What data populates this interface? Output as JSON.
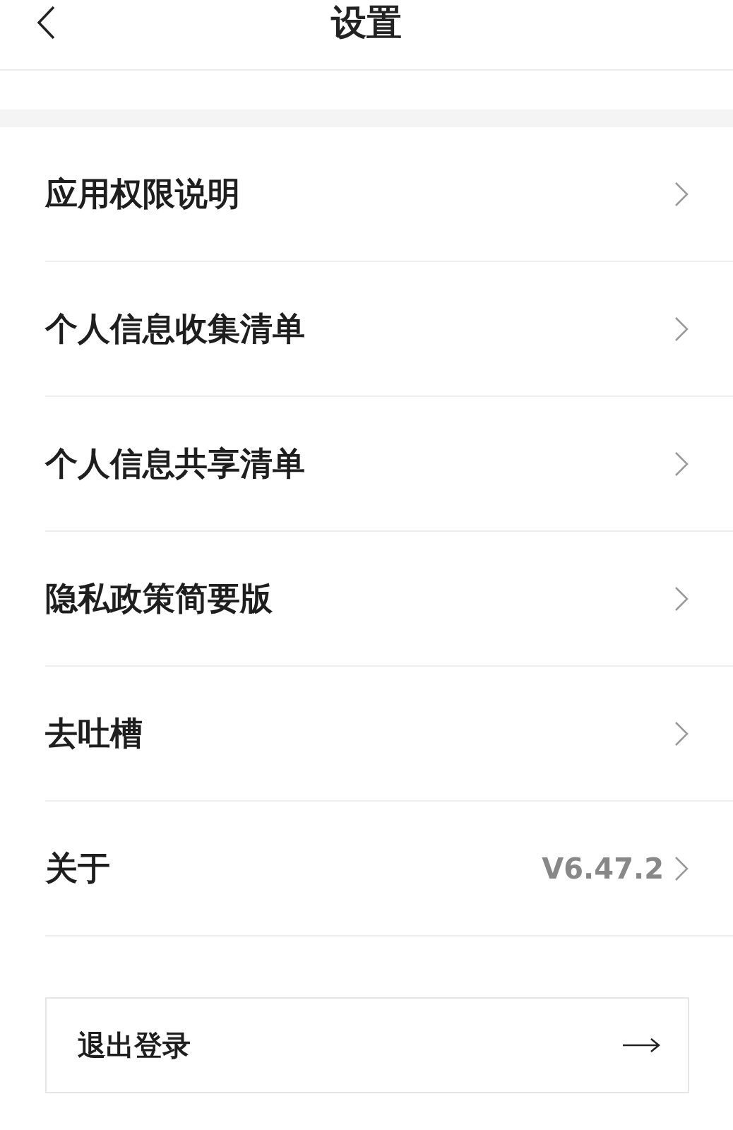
{
  "header": {
    "title": "设置"
  },
  "items": [
    {
      "label": "应用权限说明"
    },
    {
      "label": "个人信息收集清单"
    },
    {
      "label": "个人信息共享清单"
    },
    {
      "label": "隐私政策简要版"
    },
    {
      "label": "去吐槽"
    },
    {
      "label": "关于",
      "value": "V6.47.2"
    }
  ],
  "logout": {
    "label": "退出登录"
  }
}
